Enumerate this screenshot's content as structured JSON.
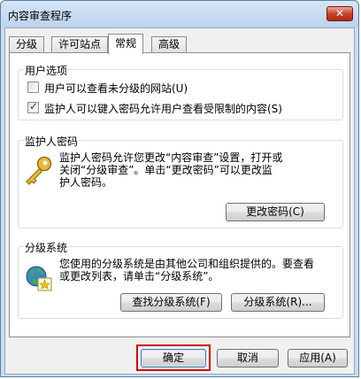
{
  "window": {
    "title": "内容审查程序",
    "close_label": "✕"
  },
  "tabs": [
    {
      "label": "分级"
    },
    {
      "label": "许可站点"
    },
    {
      "label": "常规"
    },
    {
      "label": "高级"
    }
  ],
  "user_options": {
    "legend": "用户选项",
    "option1": "用户可以查看未分级的网站(U)",
    "option1_checked": false,
    "option2": "监护人可以键入密码允许用户查看受限制的内容(S)",
    "option2_checked": true
  },
  "supervisor_password": {
    "legend": "监护人密码",
    "line1": "监护人密码允许您更改“内容审查”设置，打开或",
    "line2": "关闭“分级审查”。单击“更改密码”可以更改监",
    "line3": "护人密码。",
    "change_button": "更改密码(C)",
    "icon": "key-icon"
  },
  "rating_systems": {
    "legend": "分级系统",
    "line1": "您使用的分级系统是由其他公司和组织提供的。要查看",
    "line2": "或更改列表，请单击“分级系统”。",
    "find_button": "查找分级系统(F)",
    "systems_button": "分级系统(R)...",
    "icon": "globe-certificate-icon"
  },
  "footer": {
    "ok": "确定",
    "cancel": "取消",
    "apply": "应用(A)"
  },
  "colors": {
    "highlight": "#d40000",
    "close_button": "#c7432a"
  }
}
